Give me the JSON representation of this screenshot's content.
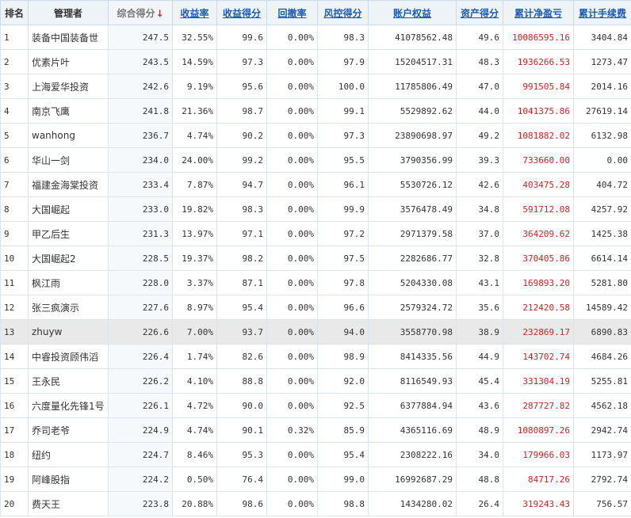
{
  "table": {
    "headers": {
      "rank": "排名",
      "manager": "管理者",
      "total_score": "综合得分",
      "sort_arrow": "↓",
      "return_rate": "收益率",
      "return_score": "收益得分",
      "drawdown": "回撤率",
      "risk_score": "风控得分",
      "equity": "账户权益",
      "asset_score": "资产得分",
      "net_profit": "累计净盈亏",
      "fees": "累计手续费"
    },
    "highlighted_row": 13,
    "rows": [
      {
        "rank": "1",
        "manager": "装备中国装备世",
        "total_score": "247.5",
        "return_rate": "32.55%",
        "return_score": "99.6",
        "drawdown": "0.00%",
        "risk_score": "98.3",
        "equity": "41078562.48",
        "asset_score": "49.6",
        "net_profit": "10086595.16",
        "fees": "3404.84"
      },
      {
        "rank": "2",
        "manager": "优素片叶",
        "total_score": "243.5",
        "return_rate": "14.59%",
        "return_score": "97.3",
        "drawdown": "0.00%",
        "risk_score": "97.9",
        "equity": "15204517.31",
        "asset_score": "48.3",
        "net_profit": "1936266.53",
        "fees": "1273.47"
      },
      {
        "rank": "3",
        "manager": "上海爱华投资",
        "total_score": "242.6",
        "return_rate": "9.19%",
        "return_score": "95.6",
        "drawdown": "0.00%",
        "risk_score": "100.0",
        "equity": "11785806.49",
        "asset_score": "47.0",
        "net_profit": "991505.84",
        "fees": "2014.16"
      },
      {
        "rank": "4",
        "manager": "南京飞鹰",
        "total_score": "241.8",
        "return_rate": "21.36%",
        "return_score": "98.7",
        "drawdown": "0.00%",
        "risk_score": "99.1",
        "equity": "5529892.62",
        "asset_score": "44.0",
        "net_profit": "1041375.86",
        "fees": "27619.14"
      },
      {
        "rank": "5",
        "manager": "wanhong",
        "total_score": "236.7",
        "return_rate": "4.74%",
        "return_score": "90.2",
        "drawdown": "0.00%",
        "risk_score": "97.3",
        "equity": "23890698.97",
        "asset_score": "49.2",
        "net_profit": "1081882.02",
        "fees": "6132.98"
      },
      {
        "rank": "6",
        "manager": "华山一剑",
        "total_score": "234.0",
        "return_rate": "24.00%",
        "return_score": "99.2",
        "drawdown": "0.00%",
        "risk_score": "95.5",
        "equity": "3790356.99",
        "asset_score": "39.3",
        "net_profit": "733660.00",
        "fees": "0.00"
      },
      {
        "rank": "7",
        "manager": "福建金海棠投资",
        "total_score": "233.4",
        "return_rate": "7.87%",
        "return_score": "94.7",
        "drawdown": "0.00%",
        "risk_score": "96.1",
        "equity": "5530726.12",
        "asset_score": "42.6",
        "net_profit": "403475.28",
        "fees": "404.72"
      },
      {
        "rank": "8",
        "manager": "大国崛起",
        "total_score": "233.0",
        "return_rate": "19.82%",
        "return_score": "98.3",
        "drawdown": "0.00%",
        "risk_score": "99.9",
        "equity": "3576478.49",
        "asset_score": "34.8",
        "net_profit": "591712.08",
        "fees": "4257.92"
      },
      {
        "rank": "9",
        "manager": "甲乙后生",
        "total_score": "231.3",
        "return_rate": "13.97%",
        "return_score": "97.1",
        "drawdown": "0.00%",
        "risk_score": "97.2",
        "equity": "2971379.58",
        "asset_score": "37.0",
        "net_profit": "364209.62",
        "fees": "1425.38"
      },
      {
        "rank": "10",
        "manager": "大国崛起2",
        "total_score": "228.5",
        "return_rate": "19.37%",
        "return_score": "98.2",
        "drawdown": "0.00%",
        "risk_score": "97.5",
        "equity": "2282686.77",
        "asset_score": "32.8",
        "net_profit": "370405.86",
        "fees": "6614.14"
      },
      {
        "rank": "11",
        "manager": "枫江雨",
        "total_score": "228.0",
        "return_rate": "3.37%",
        "return_score": "87.1",
        "drawdown": "0.00%",
        "risk_score": "97.8",
        "equity": "5204330.08",
        "asset_score": "43.1",
        "net_profit": "169893.20",
        "fees": "5281.80"
      },
      {
        "rank": "12",
        "manager": "张三疯演示",
        "total_score": "227.6",
        "return_rate": "8.97%",
        "return_score": "95.4",
        "drawdown": "0.00%",
        "risk_score": "96.6",
        "equity": "2579324.72",
        "asset_score": "35.6",
        "net_profit": "212420.58",
        "fees": "14589.42"
      },
      {
        "rank": "13",
        "manager": "zhuyw",
        "total_score": "226.6",
        "return_rate": "7.00%",
        "return_score": "93.7",
        "drawdown": "0.00%",
        "risk_score": "94.0",
        "equity": "3558770.98",
        "asset_score": "38.9",
        "net_profit": "232869.17",
        "fees": "6890.83"
      },
      {
        "rank": "14",
        "manager": "中睿投资顾伟滔",
        "total_score": "226.4",
        "return_rate": "1.74%",
        "return_score": "82.6",
        "drawdown": "0.00%",
        "risk_score": "98.9",
        "equity": "8414335.56",
        "asset_score": "44.9",
        "net_profit": "143702.74",
        "fees": "4684.26"
      },
      {
        "rank": "15",
        "manager": "王永民",
        "total_score": "226.2",
        "return_rate": "4.10%",
        "return_score": "88.8",
        "drawdown": "0.00%",
        "risk_score": "92.0",
        "equity": "8116549.93",
        "asset_score": "45.4",
        "net_profit": "331304.19",
        "fees": "5255.81"
      },
      {
        "rank": "16",
        "manager": "六度量化先锋1号",
        "total_score": "226.1",
        "return_rate": "4.72%",
        "return_score": "90.0",
        "drawdown": "0.00%",
        "risk_score": "92.5",
        "equity": "6377884.94",
        "asset_score": "43.6",
        "net_profit": "287727.82",
        "fees": "4562.18"
      },
      {
        "rank": "17",
        "manager": "乔司老爷",
        "total_score": "224.9",
        "return_rate": "4.74%",
        "return_score": "90.1",
        "drawdown": "0.32%",
        "risk_score": "85.9",
        "equity": "4365116.69",
        "asset_score": "48.9",
        "net_profit": "1080897.26",
        "fees": "2942.74"
      },
      {
        "rank": "18",
        "manager": "纽约",
        "total_score": "224.7",
        "return_rate": "8.46%",
        "return_score": "95.3",
        "drawdown": "0.00%",
        "risk_score": "95.4",
        "equity": "2308222.16",
        "asset_score": "34.0",
        "net_profit": "179966.03",
        "fees": "1173.97"
      },
      {
        "rank": "19",
        "manager": "阿峰股指",
        "total_score": "224.2",
        "return_rate": "0.50%",
        "return_score": "76.4",
        "drawdown": "0.00%",
        "risk_score": "99.0",
        "equity": "16992687.29",
        "asset_score": "48.8",
        "net_profit": "84717.26",
        "fees": "2792.74"
      },
      {
        "rank": "20",
        "manager": "费天王",
        "total_score": "223.8",
        "return_rate": "20.88%",
        "return_score": "98.6",
        "drawdown": "0.00%",
        "risk_score": "98.8",
        "equity": "1434280.02",
        "asset_score": "26.4",
        "net_profit": "319243.43",
        "fees": "756.57"
      }
    ]
  }
}
